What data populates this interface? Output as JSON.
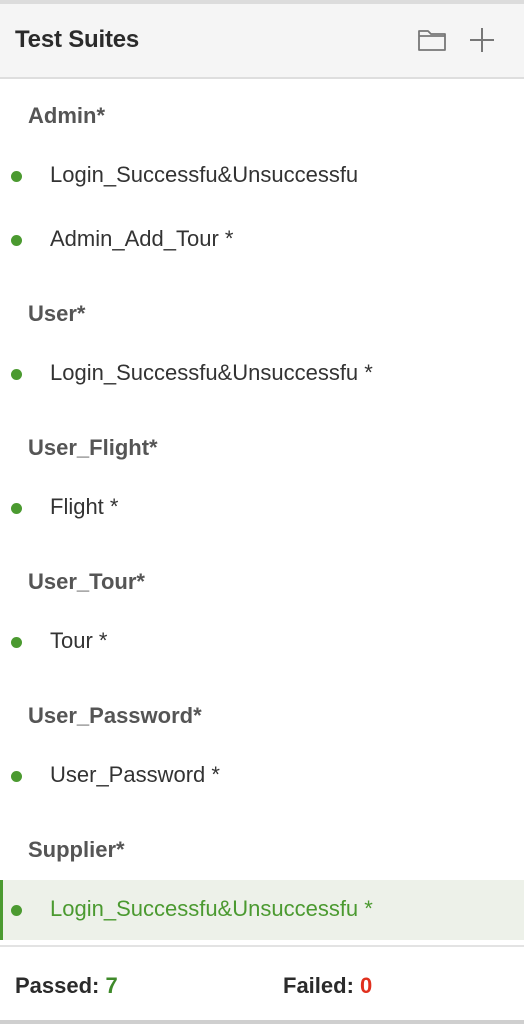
{
  "header": {
    "title": "Test Suites",
    "icons": [
      "folder-icon",
      "plus-icon"
    ]
  },
  "groups": [
    {
      "label": "Admin*",
      "suites": [
        {
          "label": "Login_Successfu&Unsuccessfu"
        },
        {
          "label": "Admin_Add_Tour *"
        }
      ]
    },
    {
      "label": "User*",
      "suites": [
        {
          "label": "Login_Successfu&Unsuccessfu *"
        }
      ]
    },
    {
      "label": "User_Flight*",
      "suites": [
        {
          "label": "Flight *"
        }
      ]
    },
    {
      "label": "User_Tour*",
      "suites": [
        {
          "label": "Tour *"
        }
      ]
    },
    {
      "label": "User_Password*",
      "suites": [
        {
          "label": "User_Password *"
        }
      ]
    },
    {
      "label": "Supplier*",
      "suites": [
        {
          "label": "Login_Successfu&Unsuccessfu *",
          "selected": true
        }
      ]
    }
  ],
  "footer": {
    "passed_label": "Passed:",
    "passed_value": "7",
    "failed_label": "Failed:",
    "failed_value": "0"
  },
  "colors": {
    "status_dot": "#4b9a30",
    "selected_text": "#4b9a30",
    "passed": "#3f8a2a",
    "failed": "#e0301e"
  }
}
